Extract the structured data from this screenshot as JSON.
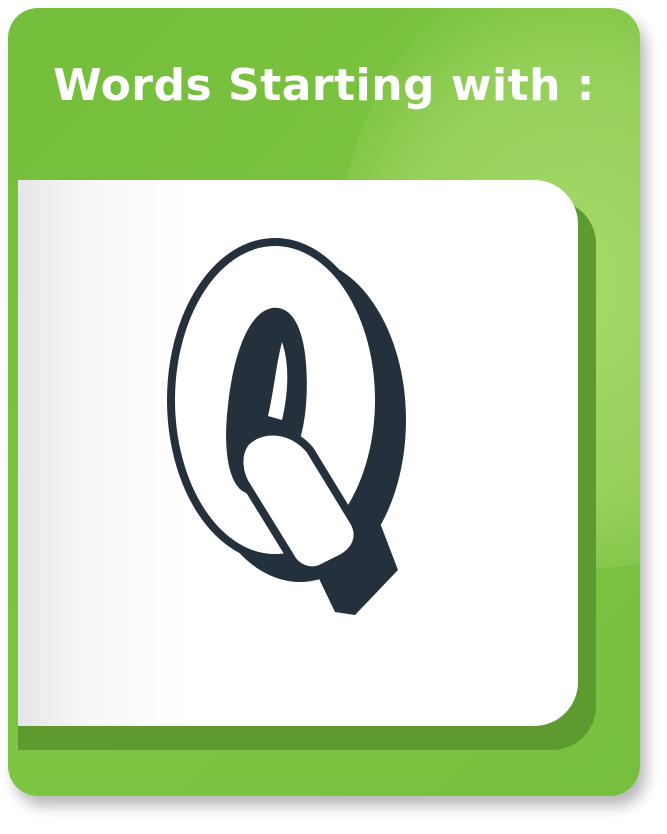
{
  "header": {
    "title": "Words Starting with :"
  },
  "letter_card": {
    "letter": "Q",
    "letter_icon": "outlined-3d-letter-q-icon"
  },
  "colors": {
    "card_green": "#7dc442",
    "card_dark_green": "#5d9a2f",
    "glow": "#a8dc68",
    "title_text": "#ffffff",
    "panel": "#ffffff",
    "letter_ink": "#25303d"
  }
}
